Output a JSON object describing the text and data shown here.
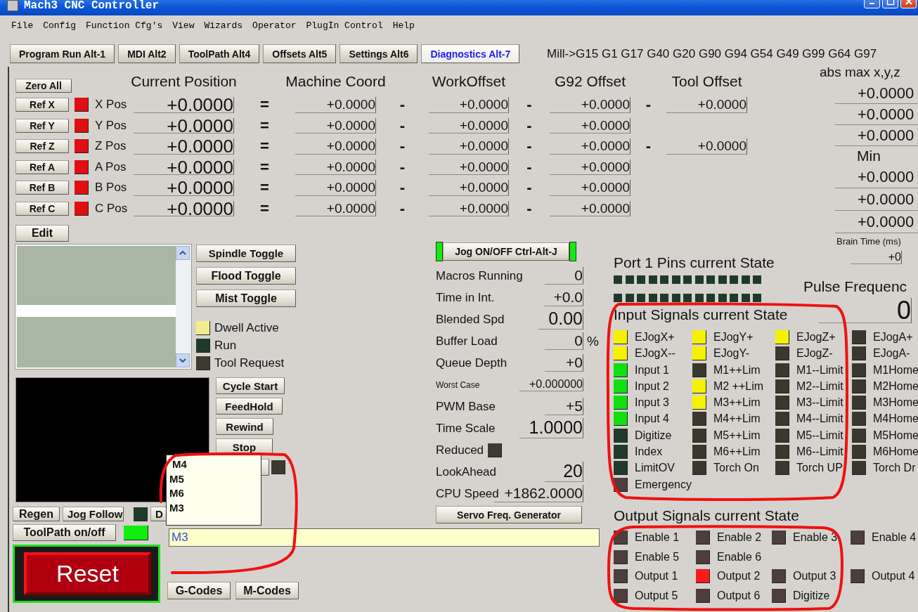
{
  "window": {
    "title": "Mach3 CNC Controller"
  },
  "menu": [
    "File",
    "Config",
    "Function Cfg's",
    "View",
    "Wizards",
    "Operator",
    "PlugIn Control",
    "Help"
  ],
  "tabs": [
    {
      "label": "Program Run Alt-1",
      "selected": false
    },
    {
      "label": "MDI Alt2",
      "selected": false
    },
    {
      "label": "ToolPath Alt4",
      "selected": false
    },
    {
      "label": "Offsets Alt5",
      "selected": false
    },
    {
      "label": "Settings Alt6",
      "selected": false
    },
    {
      "label": "Diagnostics Alt-7",
      "selected": true
    }
  ],
  "modal_codes": "Mill->G15  G1 G17 G40 G20 G90 G94 G54 G49 G99 G64 G97",
  "dro": {
    "zero_all": "Zero All",
    "headers": [
      "Current Position",
      "Machine Coord",
      "WorkOffset",
      "G92 Offset",
      "Tool Offset"
    ],
    "axes": [
      {
        "ref": "Ref X",
        "led_on": true,
        "label": "X Pos",
        "current": "+0.0000",
        "eq": "=",
        "machine": "+0.0000",
        "minus_1": "-",
        "work": "+0.0000",
        "minus_2": "-",
        "g92": "+0.0000",
        "minus_3": "-",
        "tool": "+0.0000"
      },
      {
        "ref": "Ref Y",
        "led_on": true,
        "label": "Y Pos",
        "current": "+0.0000",
        "eq": "=",
        "machine": "+0.0000",
        "minus_1": "-",
        "work": "+0.0000",
        "minus_2": "-",
        "g92": "+0.0000"
      },
      {
        "ref": "Ref Z",
        "led_on": true,
        "label": "Z Pos",
        "current": "+0.0000",
        "eq": "=",
        "machine": "+0.0000",
        "minus_1": "-",
        "work": "+0.0000",
        "minus_2": "-",
        "g92": "+0.0000",
        "minus_3": "-",
        "tool": "+0.0000"
      },
      {
        "ref": "Ref A",
        "led_on": true,
        "label": "A Pos",
        "current": "+0.0000",
        "eq": "=",
        "machine": "+0.0000",
        "minus_1": "-",
        "work": "+0.0000",
        "minus_2": "-",
        "g92": "+0.0000"
      },
      {
        "ref": "Ref B",
        "led_on": true,
        "label": "B Pos",
        "current": "+0.0000",
        "eq": "=",
        "machine": "+0.0000",
        "minus_1": "-",
        "work": "+0.0000",
        "minus_2": "-",
        "g92": "+0.0000"
      },
      {
        "ref": "Ref C",
        "led_on": true,
        "label": "C Pos",
        "current": "+0.0000",
        "eq": "=",
        "machine": "+0.0000",
        "minus_1": "-",
        "work": "+0.0000",
        "minus_2": "-",
        "g92": "+0.0000"
      }
    ]
  },
  "limits": {
    "title": "abs max x,y,z",
    "max": [
      "+0.0000",
      "+0.0000",
      "+0.0000"
    ],
    "min_label": "Min",
    "min": [
      "+0.0000",
      "+0.0000",
      "+0.0000"
    ],
    "brain_time_label": "Brain Time (ms)",
    "brain_time": "+0"
  },
  "edit_button": "Edit",
  "spindle_buttons": [
    "Spindle Toggle",
    "Flood Toggle",
    "Mist Toggle"
  ],
  "status_leds": [
    {
      "label": "Dwell Active",
      "color": "#f2ec8e"
    },
    {
      "label": "Run",
      "color": "#1f3b27"
    },
    {
      "label": "Tool Request",
      "color": "#3d3b30"
    }
  ],
  "run_buttons": [
    "Cycle Start",
    "FeedHold",
    "Rewind",
    "Stop"
  ],
  "hidden_led": {
    "on": false
  },
  "autocomplete": [
    "M4",
    "M5",
    "M6",
    "M3"
  ],
  "regen_button": "Regen",
  "jog_follow_button": "Jog Follow",
  "jog_follow_led": {
    "on": false
  },
  "display_button": "D",
  "toolpath_toggle": {
    "label": "ToolPath on/off",
    "on": true
  },
  "mdi": {
    "value": "M3"
  },
  "reset_button": "Reset",
  "code_buttons": [
    "G-Codes",
    "M-Codes"
  ],
  "jog": {
    "label": "Jog ON/OFF Ctrl-Alt-J",
    "on": true
  },
  "stats": [
    {
      "kind": "value",
      "label": "Macros Running",
      "value": "0"
    },
    {
      "kind": "value",
      "label": "Time in Int.",
      "value": "+0.0"
    },
    {
      "kind": "large",
      "label": "Blended Spd",
      "value": "0.00"
    },
    {
      "kind": "value",
      "label": "Buffer Load",
      "value": "0",
      "unit": "%"
    },
    {
      "kind": "value",
      "label": "Queue Depth",
      "value": "+0"
    },
    {
      "kind": "small",
      "label": "Worst Case",
      "value": "+0.000000"
    },
    {
      "kind": "value",
      "label": "PWM Base",
      "value": "+5"
    },
    {
      "kind": "large",
      "label": "Time Scale",
      "value": "1.0000"
    },
    {
      "kind": "led",
      "label": "Reduced",
      "color": "#3d3b30"
    },
    {
      "kind": "large",
      "label": "LookAhead",
      "value": "20"
    },
    {
      "kind": "medium",
      "label": "CPU Speed",
      "value": "+1862.0000"
    }
  ],
  "servo_button": "Servo Freq. Generator",
  "port_pins": {
    "title": "Port 1 Pins current State",
    "rows": [
      [
        false,
        false,
        false,
        false,
        false,
        false,
        false,
        false,
        false,
        false,
        false,
        false,
        false
      ],
      [
        false,
        false,
        false,
        false,
        false,
        false,
        false,
        false,
        false,
        false,
        false,
        false,
        false
      ]
    ]
  },
  "pulse": {
    "label": "Pulse Frequenc",
    "value": "0"
  },
  "inputs": {
    "title": "Input Signals current State",
    "columns": [
      [
        {
          "label": "EJogX+",
          "color": "#f5f200"
        },
        {
          "label": "EJogX--",
          "color": "#f5f200"
        },
        {
          "label": "Input 1",
          "color": "#10e010"
        },
        {
          "label": "Input 2",
          "color": "#10e010"
        },
        {
          "label": "Input 3",
          "color": "#10e010"
        },
        {
          "label": "Input 4",
          "color": "#10e010"
        },
        {
          "label": "Digitize",
          "color": "#213b2b"
        },
        {
          "label": "Index",
          "color": "#213b2b"
        },
        {
          "label": "LimitOV",
          "color": "#213b2b"
        },
        {
          "label": "Emergency",
          "color": "#4d3d3d"
        }
      ],
      [
        {
          "label": "EJogY+",
          "color": "#f5f200"
        },
        {
          "label": "EJogY-",
          "color": "#f5f200"
        },
        {
          "label": "M1++Lim",
          "color": "#3a382d"
        },
        {
          "label": "M2 ++Lim",
          "color": "#f5f200"
        },
        {
          "label": "M3++Lim",
          "color": "#f5f200"
        },
        {
          "label": "M4++Lim",
          "color": "#3a382d"
        },
        {
          "label": "M5++Lim",
          "color": "#3a382d"
        },
        {
          "label": "M6++Lim",
          "color": "#3a382d"
        },
        {
          "label": "Torch On",
          "color": "#3a382d"
        }
      ],
      [
        {
          "label": "EJogZ+",
          "color": "#f5f200"
        },
        {
          "label": "EJogZ-",
          "color": "#3a382d"
        },
        {
          "label": "M1--Limit",
          "color": "#3a382d"
        },
        {
          "label": "M2--Limit",
          "color": "#3a382d"
        },
        {
          "label": "M3--Limit",
          "color": "#3a382d"
        },
        {
          "label": "M4--Limit",
          "color": "#3a382d"
        },
        {
          "label": "M5--Limit",
          "color": "#3a382d"
        },
        {
          "label": "M6--Limit",
          "color": "#3a382d"
        },
        {
          "label": "Torch UP",
          "color": "#3a382d"
        }
      ],
      [
        {
          "label": "EJogA+",
          "color": "#3a382d"
        },
        {
          "label": "EJogA-",
          "color": "#3a382d"
        },
        {
          "label": "M1Home",
          "color": "#3a382d"
        },
        {
          "label": "M2Home",
          "color": "#3a382d"
        },
        {
          "label": "M3Home",
          "color": "#3a382d"
        },
        {
          "label": "M4Home",
          "color": "#3a382d"
        },
        {
          "label": "M5Home",
          "color": "#3a382d"
        },
        {
          "label": "M6Home",
          "color": "#3a382d"
        },
        {
          "label": "Torch Dr",
          "color": "#3a382d"
        }
      ]
    ]
  },
  "outputs": {
    "title": "Output Signals current State",
    "rows": [
      [
        {
          "label": "Enable 1",
          "color": "#4d3d3d"
        },
        {
          "label": "Enable 2",
          "color": "#4d3d3d"
        },
        {
          "label": "Enable 3",
          "color": "#4d3d3d"
        },
        {
          "label": "Enable 4",
          "color": "#4d3d3d"
        }
      ],
      [
        {
          "label": "Enable 5",
          "color": "#4d3d3d"
        },
        {
          "label": "Enable 6",
          "color": "#4d3d3d"
        }
      ],
      [
        {
          "label": "Output 1",
          "color": "#4d3d3d"
        },
        {
          "label": "Output 2",
          "color": "#ff1a1a"
        },
        {
          "label": "Output 3",
          "color": "#4d3d3d"
        },
        {
          "label": "Output 4",
          "color": "#4d3d3d"
        }
      ],
      [
        {
          "label": "Output 5",
          "color": "#4d3d3d"
        },
        {
          "label": "Output 6",
          "color": "#4d3d3d"
        },
        {
          "label": "Digitize",
          "color": "#4d3d3d"
        }
      ]
    ]
  }
}
